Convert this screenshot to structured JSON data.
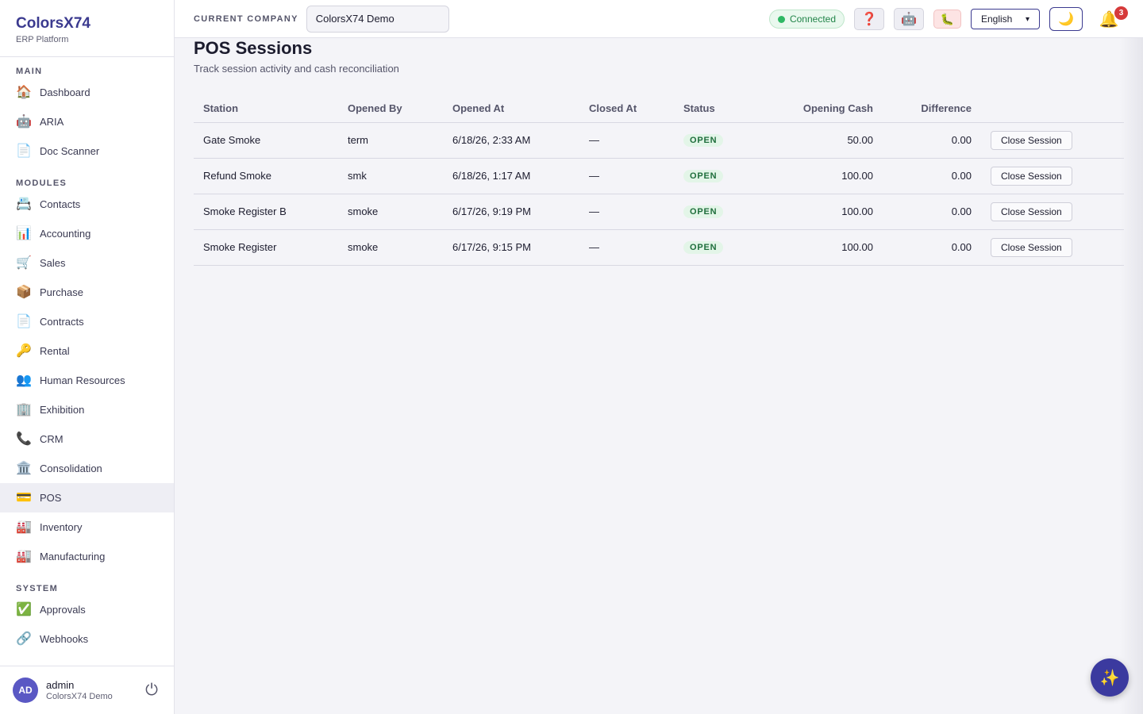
{
  "brand": {
    "name": "ColorsX74",
    "subtitle": "ERP Platform"
  },
  "sidebar": {
    "sections": [
      {
        "title": "MAIN",
        "items": [
          {
            "icon": "🏠",
            "icon_name": "home-icon",
            "label": "Dashboard"
          },
          {
            "icon": "🤖",
            "icon_name": "robot-icon",
            "label": "ARIA"
          },
          {
            "icon": "📄",
            "icon_name": "document-icon",
            "label": "Doc Scanner"
          }
        ]
      },
      {
        "title": "MODULES",
        "items": [
          {
            "icon": "📇",
            "icon_name": "card-index-icon",
            "label": "Contacts"
          },
          {
            "icon": "📊",
            "icon_name": "bar-chart-icon",
            "label": "Accounting"
          },
          {
            "icon": "🛒",
            "icon_name": "cart-icon",
            "label": "Sales"
          },
          {
            "icon": "📦",
            "icon_name": "package-icon",
            "label": "Purchase"
          },
          {
            "icon": "📄",
            "icon_name": "document-icon",
            "label": "Contracts"
          },
          {
            "icon": "🔑",
            "icon_name": "key-icon",
            "label": "Rental"
          },
          {
            "icon": "👥",
            "icon_name": "people-icon",
            "label": "Human Resources"
          },
          {
            "icon": "🏢",
            "icon_name": "building-icon",
            "label": "Exhibition"
          },
          {
            "icon": "📞",
            "icon_name": "phone-icon",
            "label": "CRM"
          },
          {
            "icon": "🏛️",
            "icon_name": "classical-building-icon",
            "label": "Consolidation"
          },
          {
            "icon": "💳",
            "icon_name": "credit-card-icon",
            "label": "POS"
          },
          {
            "icon": "🏭",
            "icon_name": "factory-icon",
            "label": "Inventory"
          },
          {
            "icon": "🏭",
            "icon_name": "factory-icon",
            "label": "Manufacturing"
          }
        ]
      },
      {
        "title": "SYSTEM",
        "items": [
          {
            "icon": "✅",
            "icon_name": "check-icon",
            "label": "Approvals"
          },
          {
            "icon": "🔗",
            "icon_name": "link-icon",
            "label": "Webhooks"
          }
        ]
      }
    ],
    "active_item": "POS"
  },
  "user": {
    "initials": "AD",
    "name": "admin",
    "company": "ColorsX74 Demo",
    "power_icon": "⏻"
  },
  "topbar": {
    "company_label": "CURRENT COMPANY",
    "company_value": "ColorsX74 Demo",
    "connection_status": "Connected",
    "help_icon": "❓",
    "bot_icon": "🤖",
    "bug_icon": "🐛",
    "language": "English",
    "theme_icon": "🌙",
    "bell_icon": "🔔",
    "notification_count": "3"
  },
  "page": {
    "title": "POS Sessions",
    "subtitle": "Track session activity and cash reconciliation"
  },
  "table": {
    "columns": [
      "Station",
      "Opened By",
      "Opened At",
      "Closed At",
      "Status",
      "Opening Cash",
      "Difference",
      ""
    ],
    "rows": [
      {
        "station": "Gate Smoke",
        "opened_by": "term",
        "opened_at": "6/18/26, 2:33 AM",
        "closed_at": "—",
        "status": "OPEN",
        "opening_cash": "50.00",
        "difference": "0.00",
        "action": "Close Session"
      },
      {
        "station": "Refund Smoke",
        "opened_by": "smk",
        "opened_at": "6/18/26, 1:17 AM",
        "closed_at": "—",
        "status": "OPEN",
        "opening_cash": "100.00",
        "difference": "0.00",
        "action": "Close Session"
      },
      {
        "station": "Smoke Register B",
        "opened_by": "smoke",
        "opened_at": "6/17/26, 9:19 PM",
        "closed_at": "—",
        "status": "OPEN",
        "opening_cash": "100.00",
        "difference": "0.00",
        "action": "Close Session"
      },
      {
        "station": "Smoke Register",
        "opened_by": "smoke",
        "opened_at": "6/17/26, 9:15 PM",
        "closed_at": "—",
        "status": "OPEN",
        "opening_cash": "100.00",
        "difference": "0.00",
        "action": "Close Session"
      }
    ]
  },
  "fab_icon": "✨",
  "colors": {
    "accent": "#3b3a8f",
    "status_open_bg": "#e3f5e8",
    "status_open_fg": "#1f6e3c",
    "connected": "#2eb864",
    "badge": "#d63a3a"
  }
}
